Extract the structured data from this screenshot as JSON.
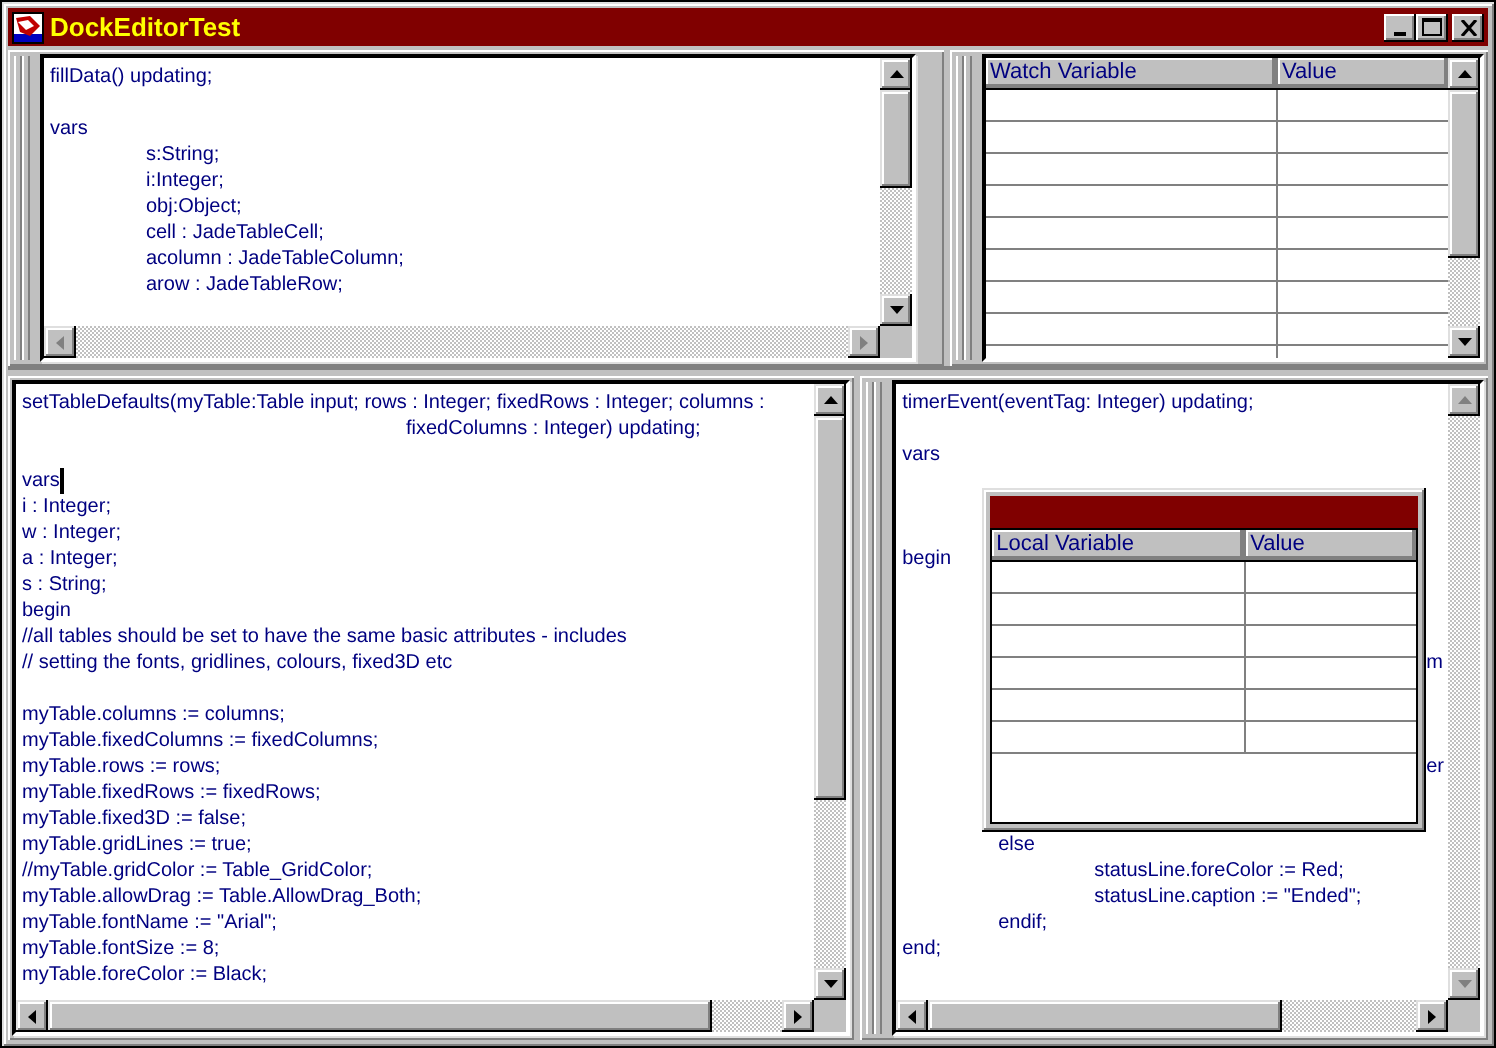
{
  "window": {
    "title": "DockEditorTest"
  },
  "top_editor": {
    "lines": [
      {
        "kind": "code",
        "text": "fillData() updating;"
      },
      {
        "kind": "blank"
      },
      {
        "kind": "code",
        "text": "vars"
      },
      {
        "kind": "code",
        "text": "\ts:String;"
      },
      {
        "kind": "code",
        "text": "\ti:Integer;"
      },
      {
        "kind": "code",
        "text": "\tobj:Object;"
      },
      {
        "kind": "code",
        "text": "\tcell : JadeTableCell;"
      },
      {
        "kind": "code",
        "text": "\tacolumn : JadeTableColumn;"
      },
      {
        "kind": "code",
        "text": "\tarow : JadeTableRow;"
      }
    ]
  },
  "watch_table": {
    "columns": [
      "Watch Variable",
      "Value"
    ]
  },
  "left_editor": {
    "lines": [
      {
        "kind": "code",
        "text": "setTableDefaults(myTable:Table input; rows : Integer; fixedRows : Integer; columns :"
      },
      {
        "kind": "code",
        "text": "\t\t\t\tfixedColumns : Integer) updating;"
      },
      {
        "kind": "blank"
      },
      {
        "kind": "caret",
        "text": "vars"
      },
      {
        "kind": "code",
        "text": "i : Integer;"
      },
      {
        "kind": "code",
        "text": "w : Integer;"
      },
      {
        "kind": "code",
        "text": "a : Integer;"
      },
      {
        "kind": "code",
        "text": "s : String;"
      },
      {
        "kind": "code",
        "text": "begin"
      },
      {
        "kind": "code",
        "text": "//all tables should be set to have the same basic attributes - includes"
      },
      {
        "kind": "code",
        "text": "// setting the fonts, gridlines, colours, fixed3D etc"
      },
      {
        "kind": "blank"
      },
      {
        "kind": "code",
        "text": "myTable.columns := columns;"
      },
      {
        "kind": "code",
        "text": "myTable.fixedColumns := fixedColumns;"
      },
      {
        "kind": "code",
        "text": "myTable.rows := rows;"
      },
      {
        "kind": "code",
        "text": "myTable.fixedRows := fixedRows;"
      },
      {
        "kind": "code",
        "text": "myTable.fixed3D := false;"
      },
      {
        "kind": "code",
        "text": "myTable.gridLines := true;"
      },
      {
        "kind": "code",
        "text": "//myTable.gridColor := Table_GridColor;"
      },
      {
        "kind": "code",
        "text": "myTable.allowDrag := Table.AllowDrag_Both;"
      },
      {
        "kind": "code",
        "text": "myTable.fontName := \"Arial\";"
      },
      {
        "kind": "code",
        "text": "myTable.fontSize := 8;"
      },
      {
        "kind": "code",
        "text": "myTable.foreColor := Black;"
      }
    ]
  },
  "right_editor": {
    "lines": [
      {
        "kind": "code",
        "text": "timerEvent(eventTag: Integer) updating;"
      },
      {
        "kind": "blank"
      },
      {
        "kind": "code",
        "text": "vars"
      },
      {
        "kind": "blank"
      },
      {
        "kind": "blank"
      },
      {
        "kind": "blank"
      },
      {
        "kind": "code",
        "text": "begin"
      },
      {
        "kind": "blank"
      },
      {
        "kind": "blank"
      },
      {
        "kind": "blank"
      },
      {
        "kind": "edge",
        "text": "m"
      },
      {
        "kind": "blank"
      },
      {
        "kind": "blank"
      },
      {
        "kind": "blank"
      },
      {
        "kind": "edge",
        "text": "er"
      },
      {
        "kind": "blank"
      },
      {
        "kind": "blank"
      },
      {
        "kind": "code",
        "text": "\telse"
      },
      {
        "kind": "code",
        "text": "\t\tstatusLine.foreColor := Red;"
      },
      {
        "kind": "code",
        "text": "\t\tstatusLine.caption := \"Ended\";"
      },
      {
        "kind": "code",
        "text": "\tendif;"
      },
      {
        "kind": "code",
        "text": "end;"
      }
    ]
  },
  "locals_window": {
    "columns": [
      "Local Variable",
      "Value"
    ]
  }
}
